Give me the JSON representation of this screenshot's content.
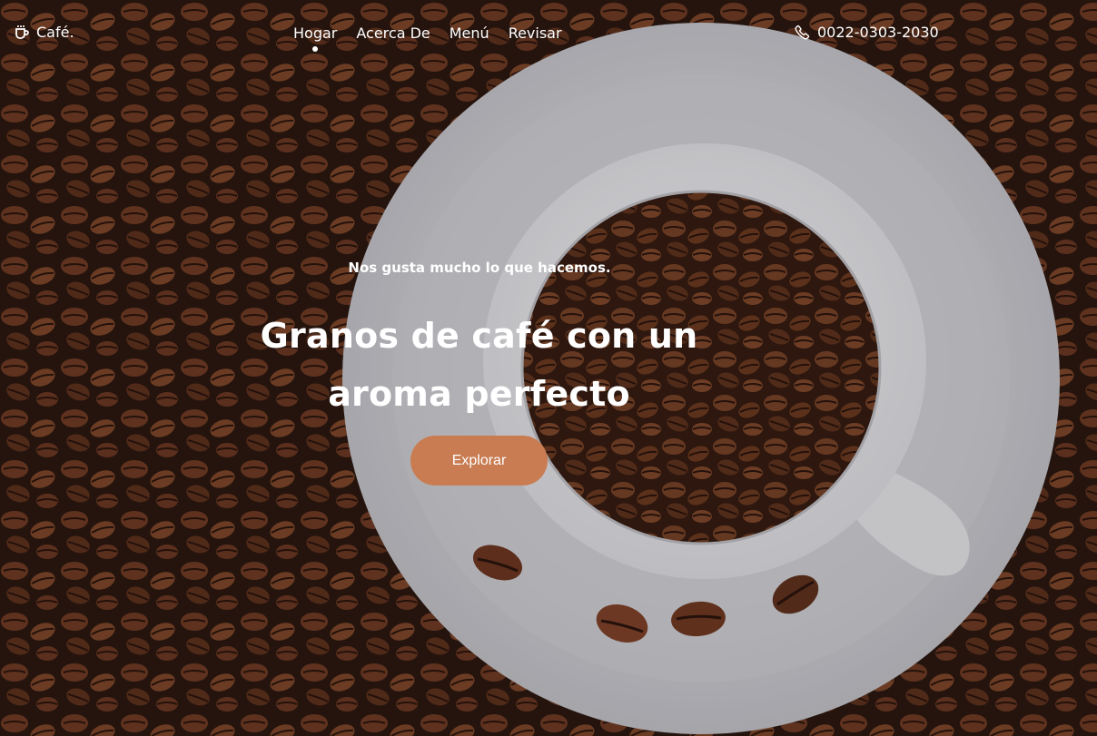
{
  "header": {
    "brand": "Café.",
    "brand_icon": "coffee-cup-icon",
    "nav": [
      "Hogar",
      "Acerca De",
      "Menú",
      "Revisar"
    ],
    "active_nav": "Hogar",
    "phone": "0022-0303-2030",
    "phone_icon": "phone-icon"
  },
  "hero": {
    "kicker": "Nos gusta mucho lo que hacemos.",
    "title_line1": "Granos de café con un",
    "title_line2": "aroma perfecto",
    "cta_label": "Explorar"
  },
  "colors": {
    "accent": "#c97c52",
    "text": "#ffffff",
    "coffee_bean": "#5a2f1c"
  }
}
